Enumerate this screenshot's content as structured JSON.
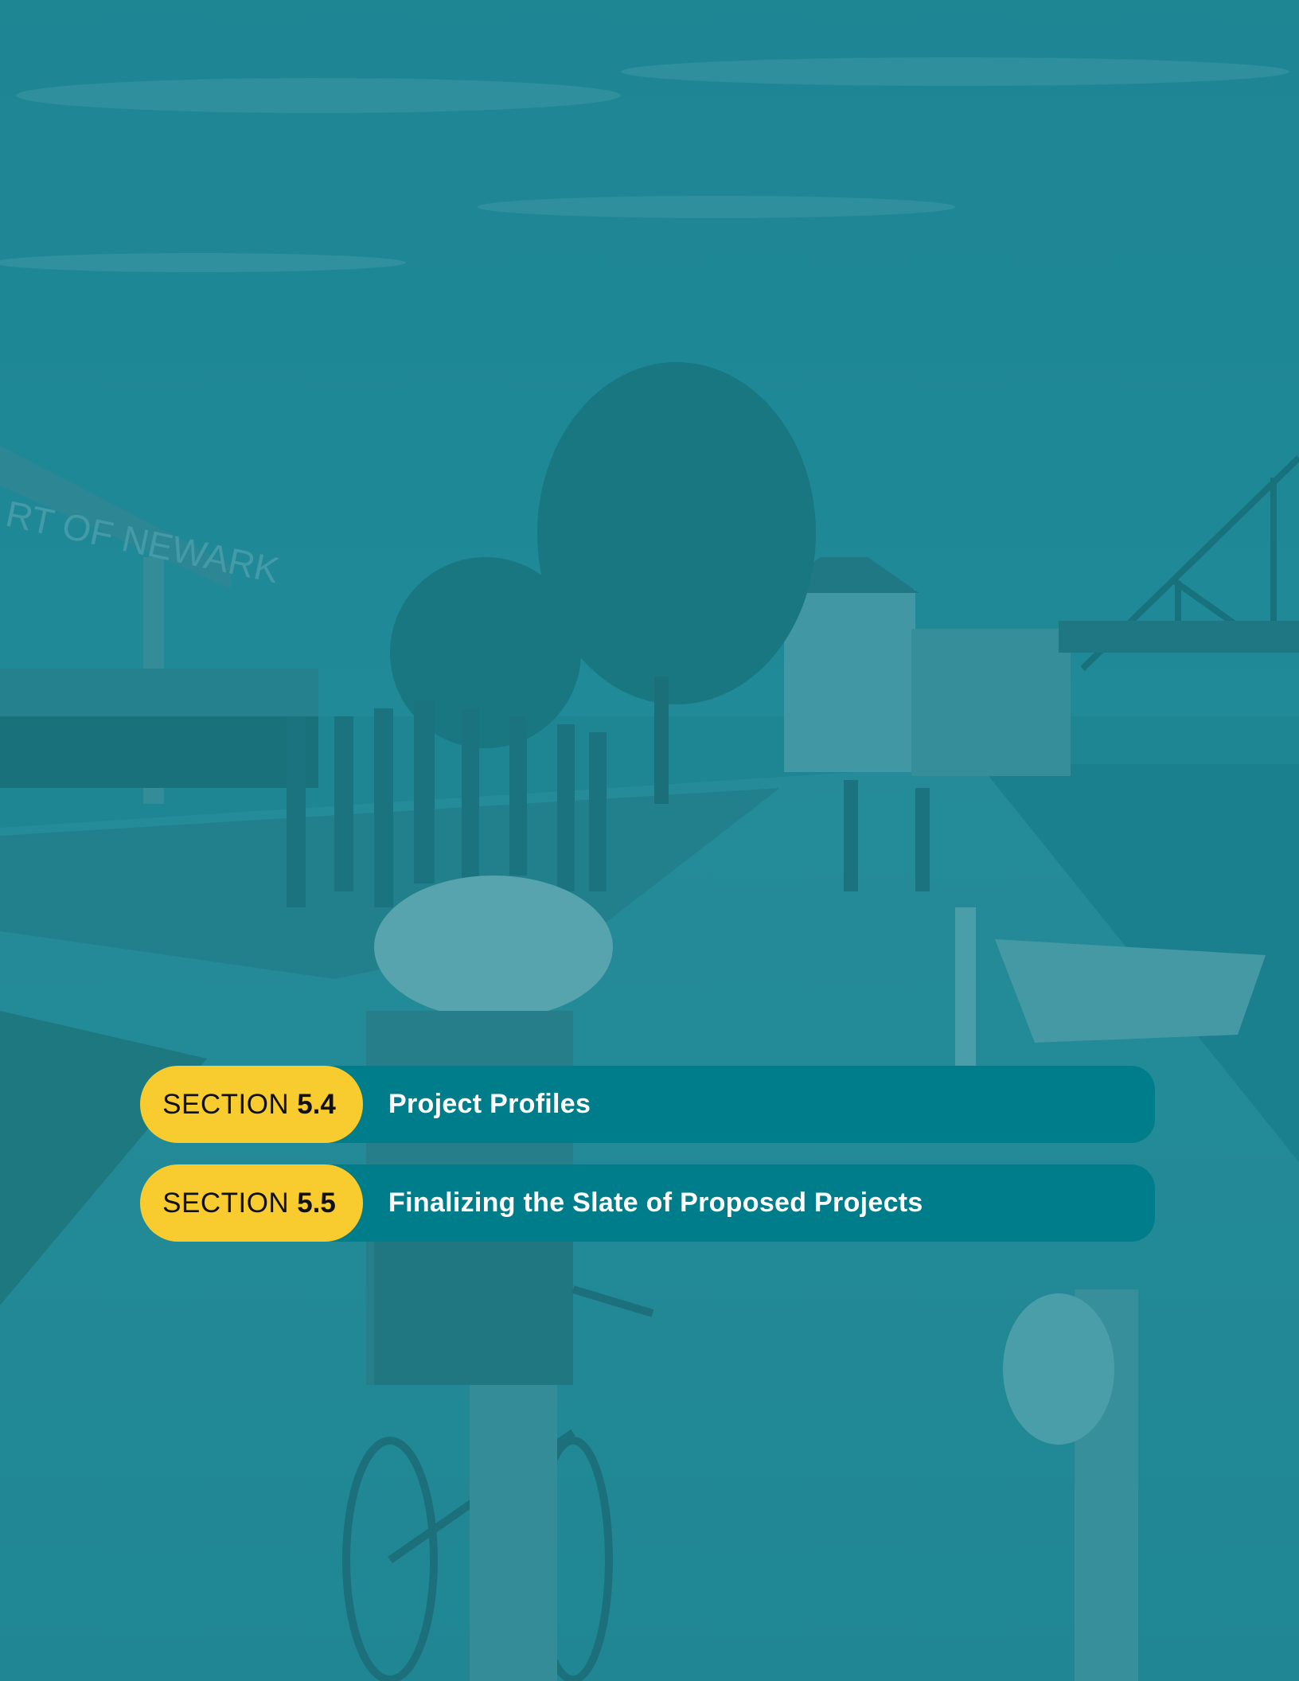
{
  "background": {
    "description_colors": {
      "tint": "#1e8a96",
      "sky": "#2f8f9a",
      "bar": "#007d8a",
      "pill": "#f8cb2e"
    },
    "sign_text": "RT OF NEWARK"
  },
  "sections": [
    {
      "label": "SECTION",
      "number": "5.4",
      "title": "Project Profiles"
    },
    {
      "label": "SECTION",
      "number": "5.5",
      "title": "Finalizing the Slate of Proposed Projects"
    }
  ]
}
